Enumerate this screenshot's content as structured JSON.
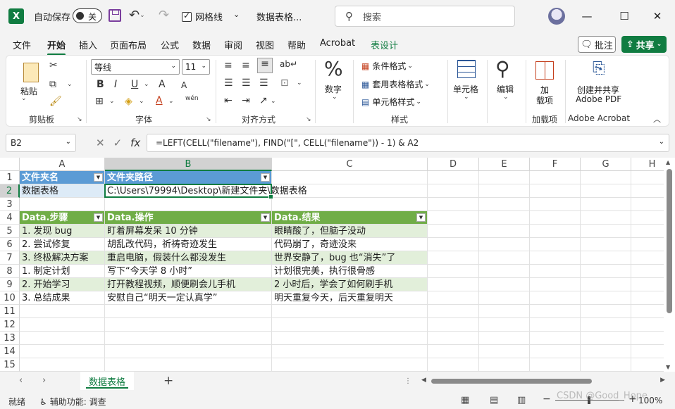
{
  "titlebar": {
    "app_logo": "X",
    "autosave_label": "自动保存",
    "autosave_state": "关",
    "grid_label": "网格线",
    "doc_title": "数据表格...",
    "search_placeholder": "搜索",
    "icons": [
      "excel-logo-icon",
      "save-icon",
      "undo-icon",
      "redo-icon",
      "search-icon",
      "minimize-icon",
      "maximize-icon",
      "close-icon"
    ]
  },
  "menu": {
    "items": [
      "文件",
      "开始",
      "插入",
      "页面布局",
      "公式",
      "数据",
      "审阅",
      "视图",
      "帮助",
      "Acrobat",
      "表设计"
    ],
    "active": "开始",
    "comment": "批注",
    "share": "共享"
  },
  "ribbon": {
    "clipboard": {
      "paste": "粘贴",
      "label": "剪贴板"
    },
    "font": {
      "name": "等线",
      "size": "11",
      "label": "字体",
      "bold": "B",
      "italic": "I",
      "underline": "U",
      "grow": "A",
      "shrink": "A",
      "font_color": "A",
      "phonetic": "wén"
    },
    "alignment": {
      "label": "对齐方式"
    },
    "number": {
      "label": "数字",
      "symbol": "%"
    },
    "styles": {
      "conditional": "条件格式",
      "table": "套用表格格式",
      "cell": "单元格样式",
      "label": "样式"
    },
    "cells": {
      "label": "单元格"
    },
    "editing": {
      "label": "编辑"
    },
    "addins": {
      "button": "加\n载项",
      "b1": "加",
      "b2": "载项",
      "label": "加载项"
    },
    "acrobat": {
      "l1": "创建并共享",
      "l2": "Adobe PDF",
      "label": "Adobe Acrobat"
    }
  },
  "formula_bar": {
    "name_box": "B2",
    "formula": "=LEFT(CELL(\"filename\"), FIND(\"[\", CELL(\"filename\")) - 1) & A2"
  },
  "grid": {
    "columns": [
      "A",
      "B",
      "C",
      "D",
      "E",
      "F",
      "G",
      "H"
    ],
    "rows": [
      "1",
      "2",
      "3",
      "4",
      "5",
      "6",
      "7",
      "8",
      "9",
      "10",
      "11",
      "12",
      "13",
      "14",
      "15"
    ],
    "selected_cell": "B2",
    "table1": {
      "headers": [
        "文件夹名",
        "文件夹路径"
      ],
      "row": [
        "数据表格",
        "C:\\Users\\79994\\Desktop\\新建文件夹\\数据表格"
      ]
    },
    "table2": {
      "headers": [
        "Data.步骤",
        "Data.操作",
        "Data.结果"
      ],
      "rows": [
        [
          "1. 发现 bug",
          "盯着屏幕发呆 10 分钟",
          "眼睛酸了，但脑子没动"
        ],
        [
          "2. 尝试修复",
          "胡乱改代码，祈祷奇迹发生",
          "代码崩了，奇迹没来"
        ],
        [
          "3. 终极解决方案",
          "重启电脑，假装什么都没发生",
          "世界安静了，bug 也“消失”了"
        ],
        [
          "1. 制定计划",
          "写下“今天学 8 小时”",
          "计划很完美，执行很骨感"
        ],
        [
          "2. 开始学习",
          "打开教程视频，顺便刷会儿手机",
          "2 小时后，学会了如何刷手机"
        ],
        [
          "3. 总结成果",
          "安慰自己“明天一定认真学”",
          "明天重复今天，后天重复明天"
        ]
      ]
    }
  },
  "sheets": {
    "tabs": [
      "数据表格"
    ],
    "active": "数据表格"
  },
  "status": {
    "ready": "就绪",
    "accessibility": "辅助功能: 调查",
    "zoom": "100%"
  },
  "watermark": "CSDN @Good_Hope"
}
